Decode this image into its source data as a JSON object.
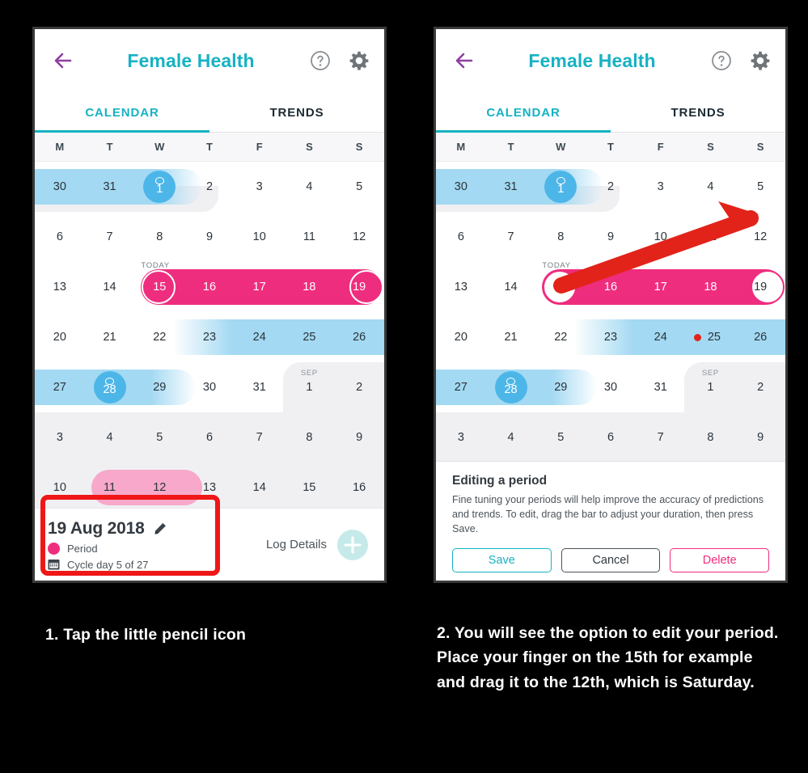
{
  "app": {
    "title": "Female Health",
    "back_icon": "back-arrow-icon",
    "help_icon": "help-circle-icon",
    "settings_icon": "gear-icon",
    "tabs": [
      {
        "label": "CALENDAR",
        "active": true
      },
      {
        "label": "TRENDS",
        "active": false
      }
    ],
    "accent_teal": "#17b2c3",
    "period_pink": "#ef2d7e",
    "fertile_blue": "#a3d9f2",
    "predicted_pink": "#f7a8cb",
    "annotation_red": "#ef1717"
  },
  "calendar": {
    "weekdays": [
      "M",
      "T",
      "W",
      "T",
      "F",
      "S",
      "S"
    ],
    "today_label": "TODAY",
    "month_label_sep": "SEP",
    "weeks": [
      {
        "days": [
          "30",
          "31",
          "1",
          "2",
          "3",
          "4",
          "5"
        ]
      },
      {
        "days": [
          "6",
          "7",
          "8",
          "9",
          "10",
          "11",
          "12"
        ]
      },
      {
        "days": [
          "13",
          "14",
          "15",
          "16",
          "17",
          "18",
          "19"
        ]
      },
      {
        "days": [
          "20",
          "21",
          "22",
          "23",
          "24",
          "25",
          "26"
        ]
      },
      {
        "days": [
          "27",
          "28",
          "29",
          "30",
          "31",
          "1",
          "2"
        ]
      },
      {
        "days": [
          "3",
          "4",
          "5",
          "6",
          "7",
          "8",
          "9"
        ]
      },
      {
        "days": [
          "10",
          "11",
          "12",
          "13",
          "14",
          "15",
          "16"
        ]
      }
    ],
    "ovulation_days": [
      "1",
      "28"
    ],
    "period_range": [
      "15",
      "19"
    ],
    "fertile_ranges": [
      [
        "30",
        "2"
      ],
      [
        "23",
        "26"
      ],
      [
        "27",
        "29"
      ]
    ],
    "predicted_range": [
      "11",
      "13"
    ],
    "marked_day": "25"
  },
  "detail": {
    "date": "19 Aug 2018",
    "edit_icon": "pencil-icon",
    "status_label": "Period",
    "cycle_label": "Cycle day 5 of 27",
    "cycle_icon": "calendar-icon",
    "log_label": "Log Details",
    "add_icon": "plus-icon"
  },
  "edit_panel": {
    "title": "Editing a period",
    "body": "Fine tuning your periods will help improve the accuracy of predictions and trends. To edit, drag the bar to adjust your duration, then press Save.",
    "buttons": [
      {
        "label": "Save",
        "style": "save"
      },
      {
        "label": "Cancel",
        "style": "cancel"
      },
      {
        "label": "Delete",
        "style": "delete"
      }
    ]
  },
  "captions": {
    "step1": "1. Tap the little pencil icon",
    "step2": "2.  You will see the option to edit your period. Place your finger on the 15th for example and drag it to the 12th, which is Saturday."
  }
}
